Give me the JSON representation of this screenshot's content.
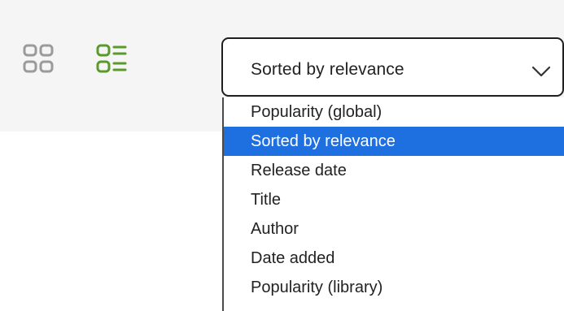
{
  "view_toggle": {
    "grid_icon": "grid-view-icon",
    "list_icon": "list-view-icon",
    "active_view": "list",
    "active_color": "#5a9a2a",
    "inactive_color": "#9a9a9a"
  },
  "sort": {
    "selected_label": "Sorted by relevance",
    "chevron_icon": "chevron-down-icon",
    "options": [
      {
        "label": "Popularity (global)",
        "selected": false
      },
      {
        "label": "Sorted by relevance",
        "selected": true
      },
      {
        "label": "Release date",
        "selected": false
      },
      {
        "label": "Title",
        "selected": false
      },
      {
        "label": "Author",
        "selected": false
      },
      {
        "label": "Date added",
        "selected": false
      },
      {
        "label": "Popularity (library)",
        "selected": false
      }
    ],
    "highlight_color": "#1e6fe0"
  }
}
